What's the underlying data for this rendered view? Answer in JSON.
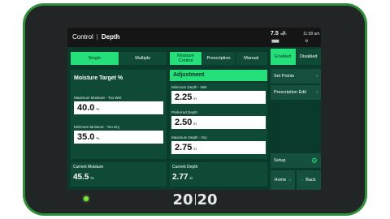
{
  "header": {
    "app": "Control",
    "page": "Depth",
    "speed_value": "7.5",
    "speed_unit": "mph",
    "clock": "11:58 am"
  },
  "mode_toggle": {
    "options": [
      "Single",
      "Multiple"
    ],
    "selected": "Single"
  },
  "source_toggle": {
    "options": [
      "Moisture Control",
      "Prescription",
      "Manual"
    ],
    "selected": "Moisture Control"
  },
  "state_toggle": {
    "options": [
      "Enabled",
      "Disabled"
    ],
    "selected": "Enabled"
  },
  "moisture_target": {
    "title": "Moisture Target %",
    "max_label": "Maximum Moisture - Too Wet",
    "max_value": "40.0",
    "min_label": "Minimum Moisture - Too Dry",
    "min_value": "35.0",
    "unit": "%"
  },
  "adjustment": {
    "title": "Adjustment",
    "min_label": "Minimum Depth - Wet",
    "min_value": "2.25",
    "pref_label": "Preferred Depth",
    "pref_value": "2.50",
    "max_label": "Maximum Depth - Dry",
    "max_value": "2.75",
    "unit": "in"
  },
  "readouts": {
    "moisture_label": "Current Moisture",
    "moisture_value": "45.5",
    "moisture_unit": "%",
    "depth_label": "Current Depth",
    "depth_value": "2.77",
    "depth_unit": "in"
  },
  "side_menu": {
    "set_points": "Set Points",
    "prescription_edit": "Prescription Edit",
    "setup": "Setup",
    "home": "Home",
    "back": "Back"
  },
  "brand": {
    "left": "20",
    "right": "20"
  },
  "colors": {
    "accent": "#25e07a",
    "panel": "#0f4a37",
    "screen_bg": "#0a3a2c",
    "bezel": "#2f8f3a"
  }
}
